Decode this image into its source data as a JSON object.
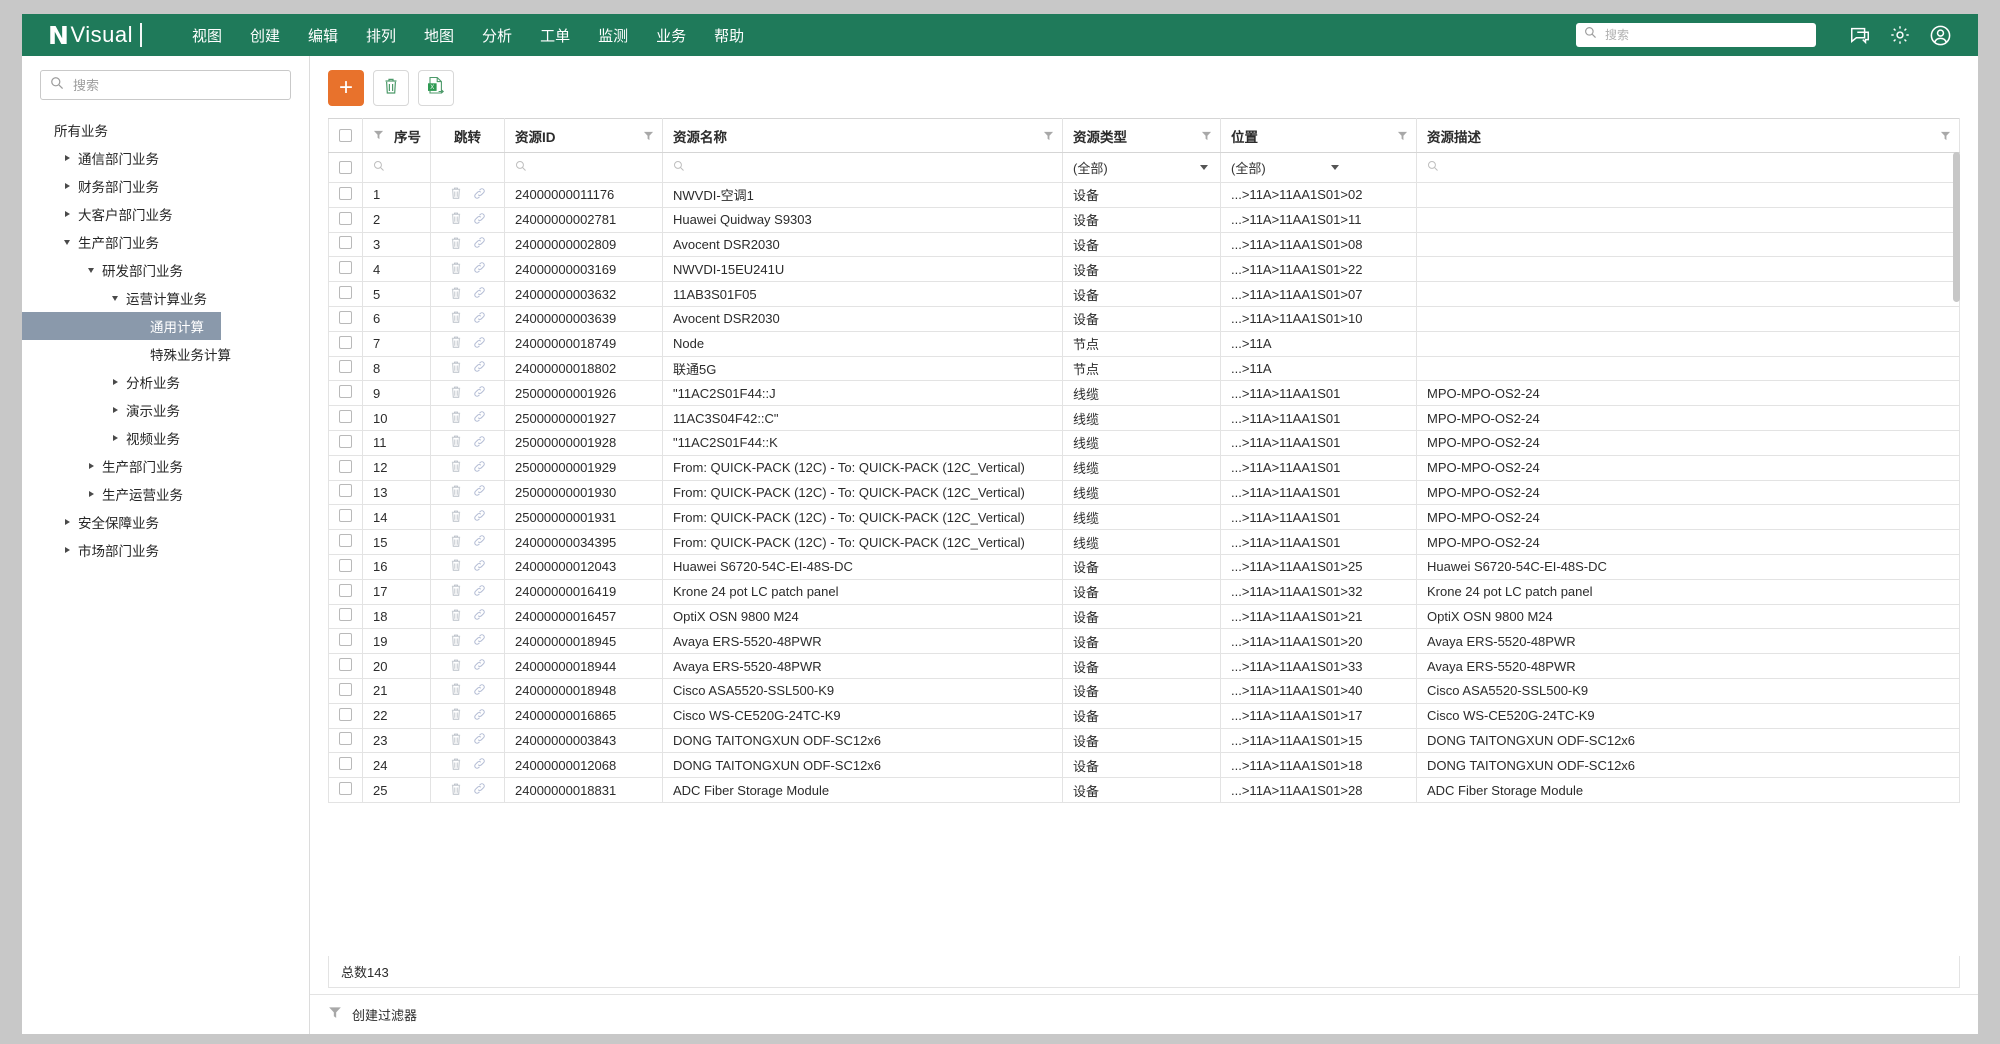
{
  "header": {
    "brand_mark": "N",
    "brand_name": "Visual",
    "menu": [
      {
        "label": "视图"
      },
      {
        "label": "创建"
      },
      {
        "label": "编辑"
      },
      {
        "label": "排列"
      },
      {
        "label": "地图"
      },
      {
        "label": "分析"
      },
      {
        "label": "工单"
      },
      {
        "label": "监测"
      },
      {
        "label": "业务"
      },
      {
        "label": "帮助"
      }
    ],
    "search_placeholder": "搜索",
    "search_value": "",
    "icons": [
      "chat-icon",
      "gear-icon",
      "user-icon"
    ],
    "accent_color": "#1f7a5a"
  },
  "sidebar": {
    "search_placeholder": "搜索",
    "search_value": "",
    "tree": [
      {
        "label": "所有业务",
        "depth": 0,
        "toggle": "none",
        "selected": false
      },
      {
        "label": "通信部门业务",
        "depth": 1,
        "toggle": "right",
        "selected": false
      },
      {
        "label": "财务部门业务",
        "depth": 1,
        "toggle": "right",
        "selected": false
      },
      {
        "label": "大客户部门业务",
        "depth": 1,
        "toggle": "right",
        "selected": false
      },
      {
        "label": "生产部门业务",
        "depth": 1,
        "toggle": "down",
        "selected": false
      },
      {
        "label": "研发部门业务",
        "depth": 2,
        "toggle": "down",
        "selected": false
      },
      {
        "label": "运营计算业务",
        "depth": 3,
        "toggle": "down",
        "selected": false
      },
      {
        "label": "通用计算",
        "depth": 4,
        "toggle": "none",
        "selected": true
      },
      {
        "label": "特殊业务计算",
        "depth": 4,
        "toggle": "none",
        "selected": false
      },
      {
        "label": "分析业务",
        "depth": 3,
        "toggle": "right",
        "selected": false
      },
      {
        "label": "演示业务",
        "depth": 3,
        "toggle": "right",
        "selected": false
      },
      {
        "label": "视频业务",
        "depth": 3,
        "toggle": "right",
        "selected": false
      },
      {
        "label": "生产部门业务",
        "depth": 2,
        "toggle": "right",
        "selected": false
      },
      {
        "label": "生产运营业务",
        "depth": 2,
        "toggle": "right",
        "selected": false
      },
      {
        "label": "安全保障业务",
        "depth": 1,
        "toggle": "right",
        "selected": false
      },
      {
        "label": "市场部门业务",
        "depth": 1,
        "toggle": "right",
        "selected": false
      }
    ]
  },
  "toolbar": {
    "add_label": "+",
    "add_color": "#e8722c",
    "buttons": [
      "add-button",
      "delete-button",
      "export-excel-button"
    ]
  },
  "table": {
    "columns": [
      {
        "key": "checkbox",
        "label": "",
        "filter": false
      },
      {
        "key": "seq",
        "label": "序号",
        "filter": true
      },
      {
        "key": "jump",
        "label": "跳转",
        "filter": false
      },
      {
        "key": "id",
        "label": "资源ID",
        "filter": true
      },
      {
        "key": "name",
        "label": "资源名称",
        "filter": true
      },
      {
        "key": "type",
        "label": "资源类型",
        "filter": true
      },
      {
        "key": "location",
        "label": "位置",
        "filter": true
      },
      {
        "key": "description",
        "label": "资源描述",
        "filter": true
      }
    ],
    "filter_row": {
      "seq_placeholder": "",
      "id_placeholder": "",
      "name_placeholder": "",
      "type_value": "(全部)",
      "location_value": "(全部)",
      "description_placeholder": ""
    },
    "rows": [
      {
        "seq": "1",
        "id": "24000000011176",
        "name": "NWVDI-空调1",
        "type": "设备",
        "location": "...>11A>11AA1S01>02",
        "description": ""
      },
      {
        "seq": "2",
        "id": "24000000002781",
        "name": "Huawei Quidway S9303",
        "type": "设备",
        "location": "...>11A>11AA1S01>11",
        "description": ""
      },
      {
        "seq": "3",
        "id": "24000000002809",
        "name": "Avocent DSR2030",
        "type": "设备",
        "location": "...>11A>11AA1S01>08",
        "description": ""
      },
      {
        "seq": "4",
        "id": "24000000003169",
        "name": "NWVDI-15EU241U",
        "type": "设备",
        "location": "...>11A>11AA1S01>22",
        "description": ""
      },
      {
        "seq": "5",
        "id": "24000000003632",
        "name": "11AB3S01F05",
        "type": "设备",
        "location": "...>11A>11AA1S01>07",
        "description": ""
      },
      {
        "seq": "6",
        "id": "24000000003639",
        "name": "Avocent DSR2030",
        "type": "设备",
        "location": "...>11A>11AA1S01>10",
        "description": ""
      },
      {
        "seq": "7",
        "id": "24000000018749",
        "name": "Node",
        "type": "节点",
        "location": "...>11A",
        "description": ""
      },
      {
        "seq": "8",
        "id": "24000000018802",
        "name": "联通5G",
        "type": "节点",
        "location": "...>11A",
        "description": ""
      },
      {
        "seq": "9",
        "id": "25000000001926",
        "name": "\"11AC2S01F44::J",
        "type": "线缆",
        "location": "...>11A>11AA1S01",
        "description": "MPO-MPO-OS2-24"
      },
      {
        "seq": "10",
        "id": "25000000001927",
        "name": "11AC3S04F42::C\"",
        "type": "线缆",
        "location": "...>11A>11AA1S01",
        "description": "MPO-MPO-OS2-24"
      },
      {
        "seq": "11",
        "id": "25000000001928",
        "name": "\"11AC2S01F44::K",
        "type": "线缆",
        "location": "...>11A>11AA1S01",
        "description": "MPO-MPO-OS2-24"
      },
      {
        "seq": "12",
        "id": "25000000001929",
        "name": "From: QUICK-PACK (12C) - To: QUICK-PACK (12C_Vertical)",
        "type": "线缆",
        "location": "...>11A>11AA1S01",
        "description": "MPO-MPO-OS2-24"
      },
      {
        "seq": "13",
        "id": "25000000001930",
        "name": "From: QUICK-PACK (12C) - To: QUICK-PACK (12C_Vertical)",
        "type": "线缆",
        "location": "...>11A>11AA1S01",
        "description": "MPO-MPO-OS2-24"
      },
      {
        "seq": "14",
        "id": "25000000001931",
        "name": "From: QUICK-PACK (12C) - To: QUICK-PACK (12C_Vertical)",
        "type": "线缆",
        "location": "...>11A>11AA1S01",
        "description": "MPO-MPO-OS2-24"
      },
      {
        "seq": "15",
        "id": "24000000034395",
        "name": "From: QUICK-PACK (12C) - To: QUICK-PACK (12C_Vertical)",
        "type": "线缆",
        "location": "...>11A>11AA1S01",
        "description": "MPO-MPO-OS2-24"
      },
      {
        "seq": "16",
        "id": "24000000012043",
        "name": "Huawei S6720-54C-EI-48S-DC",
        "type": "设备",
        "location": "...>11A>11AA1S01>25",
        "description": "Huawei S6720-54C-EI-48S-DC"
      },
      {
        "seq": "17",
        "id": "24000000016419",
        "name": "Krone 24 pot LC patch panel",
        "type": "设备",
        "location": "...>11A>11AA1S01>32",
        "description": "Krone 24 pot LC patch panel"
      },
      {
        "seq": "18",
        "id": "24000000016457",
        "name": "OptiX OSN 9800 M24",
        "type": "设备",
        "location": "...>11A>11AA1S01>21",
        "description": "OptiX OSN 9800 M24"
      },
      {
        "seq": "19",
        "id": "24000000018945",
        "name": "Avaya ERS-5520-48PWR",
        "type": "设备",
        "location": "...>11A>11AA1S01>20",
        "description": "Avaya ERS-5520-48PWR"
      },
      {
        "seq": "20",
        "id": "24000000018944",
        "name": "Avaya ERS-5520-48PWR",
        "type": "设备",
        "location": "...>11A>11AA1S01>33",
        "description": "Avaya ERS-5520-48PWR"
      },
      {
        "seq": "21",
        "id": "24000000018948",
        "name": "Cisco ASA5520-SSL500-K9",
        "type": "设备",
        "location": "...>11A>11AA1S01>40",
        "description": "Cisco ASA5520-SSL500-K9"
      },
      {
        "seq": "22",
        "id": "24000000016865",
        "name": "Cisco WS-CE520G-24TC-K9",
        "type": "设备",
        "location": "...>11A>11AA1S01>17",
        "description": "Cisco WS-CE520G-24TC-K9"
      },
      {
        "seq": "23",
        "id": "24000000003843",
        "name": "DONG TAITONGXUN ODF-SC12x6",
        "type": "设备",
        "location": "...>11A>11AA1S01>15",
        "description": "DONG TAITONGXUN ODF-SC12x6"
      },
      {
        "seq": "24",
        "id": "24000000012068",
        "name": "DONG TAITONGXUN ODF-SC12x6",
        "type": "设备",
        "location": "...>11A>11AA1S01>18",
        "description": "DONG TAITONGXUN ODF-SC12x6"
      },
      {
        "seq": "25",
        "id": "24000000018831",
        "name": "ADC Fiber Storage Module",
        "type": "设备",
        "location": "...>11A>11AA1S01>28",
        "description": "ADC Fiber Storage Module"
      }
    ],
    "total_label": "总数143"
  },
  "footer": {
    "create_filter_label": "创建过滤器"
  }
}
